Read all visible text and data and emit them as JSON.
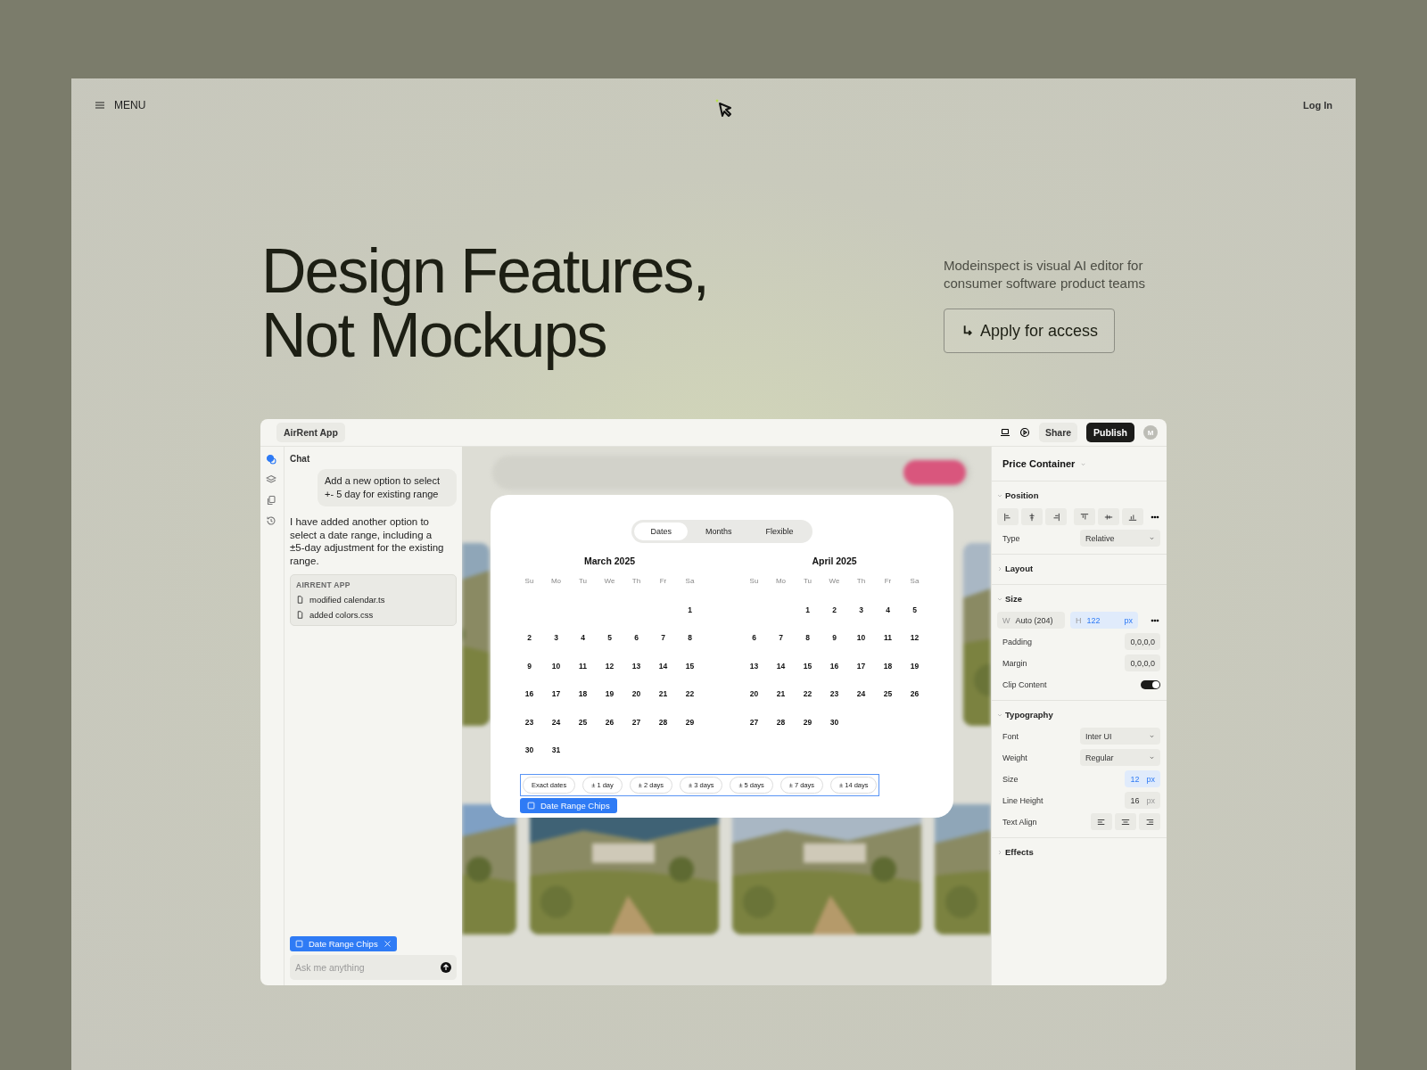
{
  "header": {
    "menu_label": "MENU",
    "login": "Log In"
  },
  "hero": {
    "title_lines": [
      "Design Features,",
      "Not Mockups"
    ],
    "tagline": "Modeinspect is visual AI editor for consumer software product teams",
    "cta": "Apply for access"
  },
  "app": {
    "title": "AirRent App",
    "share": "Share",
    "publish": "Publish",
    "avatar": "M",
    "rail": [
      {
        "selected": true
      },
      {
        "selected": false
      },
      {
        "selected": false
      },
      {
        "selected": false
      }
    ],
    "chat": {
      "heading": "Chat",
      "messages": [
        {
          "kind": "prompt",
          "text": "Add a new option to select +- 5 day for existing range"
        },
        {
          "kind": "reply",
          "text": "I have added another option to select a date range, including a ±5-day adjustment for the existing range."
        }
      ],
      "changes": {
        "title": "AIRRENT APP",
        "files": [
          "modified calendar.ts",
          "added colors.css"
        ]
      },
      "context_chip": "Date Range Chips",
      "input_placeholder": "Ask me anything"
    },
    "calendar": {
      "tabs": [
        {
          "label": "Dates",
          "selected": true
        },
        {
          "label": "Months",
          "selected": false
        },
        {
          "label": "Flexible",
          "selected": false
        }
      ],
      "months": [
        {
          "title": "March 2025",
          "weekdays": [
            "Su",
            "Mo",
            "Tu",
            "We",
            "Th",
            "Fr",
            "Sa"
          ],
          "weeks": [
            {
              "kind": "first",
              "days": [
                "1"
              ]
            },
            {
              "kind": "full",
              "days": [
                "2",
                "3",
                "4",
                "5",
                "6",
                "7",
                "8"
              ]
            },
            {
              "kind": "full",
              "days": [
                "9",
                "10",
                "11",
                "12",
                "13",
                "14",
                "15"
              ]
            },
            {
              "kind": "full",
              "days": [
                "16",
                "17",
                "18",
                "19",
                "20",
                "21",
                "22"
              ]
            },
            {
              "kind": "full",
              "days": [
                "23",
                "24",
                "25",
                "26",
                "27",
                "28",
                "29"
              ]
            },
            {
              "kind": "last",
              "days": [
                "30",
                "31"
              ]
            }
          ]
        },
        {
          "title": "April 2025",
          "weekdays": [
            "Su",
            "Mo",
            "Tu",
            "We",
            "Th",
            "Fr",
            "Sa"
          ],
          "weeks": [
            {
              "kind": "first",
              "days": [
                "1",
                "2",
                "3",
                "4",
                "5"
              ]
            },
            {
              "kind": "full",
              "days": [
                "6",
                "7",
                "8",
                "9",
                "10",
                "11",
                "12"
              ]
            },
            {
              "kind": "full",
              "days": [
                "13",
                "14",
                "15",
                "16",
                "17",
                "18",
                "19"
              ]
            },
            {
              "kind": "full",
              "days": [
                "20",
                "21",
                "22",
                "23",
                "24",
                "25",
                "26"
              ]
            },
            {
              "kind": "last",
              "days": [
                "27",
                "28",
                "29",
                "30"
              ]
            }
          ]
        }
      ],
      "chips": [
        "Exact dates",
        "± 1 day",
        "± 2 days",
        "± 3 days",
        "± 5 days",
        "± 7 days",
        "± 14 days"
      ],
      "selection_label": "Date Range Chips"
    },
    "inspector": {
      "title": "Price Container",
      "sections": [
        {
          "title": "Position",
          "expanded": true,
          "rows": [
            {
              "kind": "align"
            },
            {
              "kind": "select",
              "label": "Type",
              "value": "Relative"
            }
          ]
        },
        {
          "title": "Layout",
          "expanded": false
        },
        {
          "title": "Size",
          "expanded": true,
          "rows": [
            {
              "kind": "dimensions",
              "w_prefix": "W",
              "w_value": "Auto (204)",
              "h_prefix": "H",
              "h_value": "122",
              "h_unit": "px",
              "active": true
            },
            {
              "kind": "value",
              "label": "Padding",
              "value": "0,0,0,0"
            },
            {
              "kind": "value",
              "label": "Margin",
              "value": "0,0,0,0"
            },
            {
              "kind": "toggle",
              "label": "Clip Content",
              "on": true
            }
          ]
        },
        {
          "title": "Typography",
          "expanded": true,
          "rows": [
            {
              "kind": "select",
              "label": "Font",
              "value": "Inter UI"
            },
            {
              "kind": "select",
              "label": "Weight",
              "value": "Regular"
            },
            {
              "kind": "unit",
              "label": "Size",
              "value": "12",
              "unit": "px",
              "active": true
            },
            {
              "kind": "unit",
              "label": "Line Height",
              "value": "16",
              "unit": "px",
              "active": false
            },
            {
              "kind": "textalign",
              "label": "Text Align"
            }
          ]
        },
        {
          "title": "Effects",
          "expanded": false
        }
      ]
    }
  }
}
